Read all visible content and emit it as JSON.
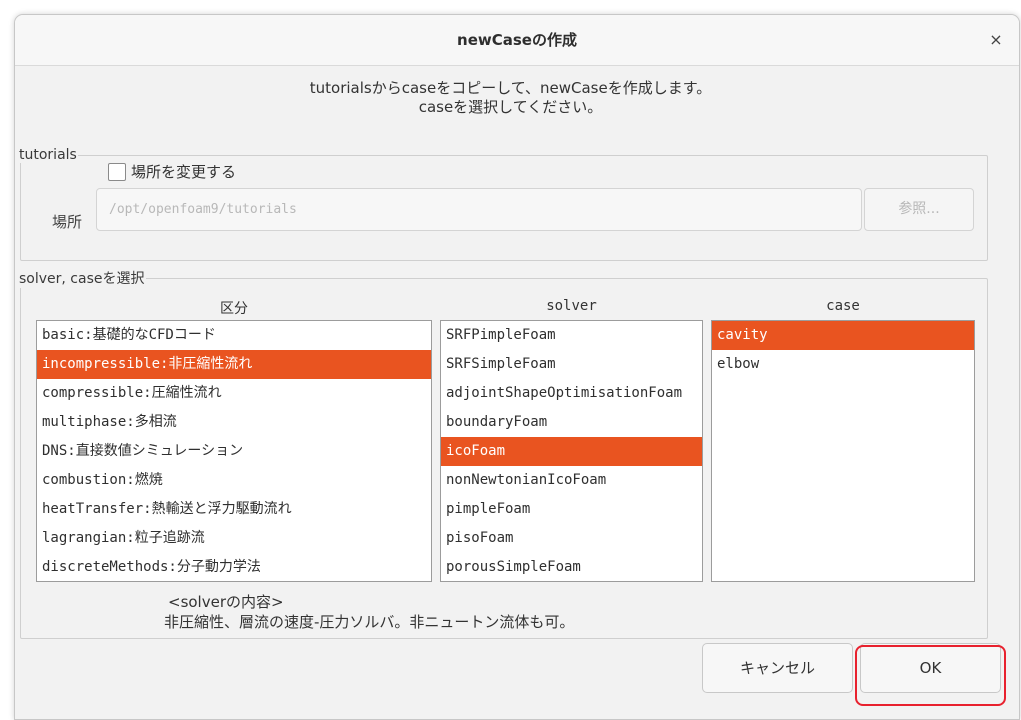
{
  "dialog": {
    "title": "newCaseの作成",
    "close_symbol": "×",
    "intro_line1": "tutorialsからcaseをコピーして、newCaseを作成します。",
    "intro_line2": "caseを選択してください。"
  },
  "tutorials": {
    "legend": "tutorials",
    "change_location_label": "場所を変更する",
    "change_location_checked": false,
    "location_label": "場所",
    "location_value": "/opt/openfoam9/tutorials",
    "browse_label": "参照..."
  },
  "selection": {
    "legend": "solver, caseを選択",
    "category_header": "区分",
    "solver_header": "solver",
    "case_header": "case",
    "categories": [
      {
        "label": "basic:基礎的なCFDコード",
        "selected": false
      },
      {
        "label": "incompressible:非圧縮性流れ",
        "selected": true
      },
      {
        "label": "compressible:圧縮性流れ",
        "selected": false
      },
      {
        "label": "multiphase:多相流",
        "selected": false
      },
      {
        "label": "DNS:直接数値シミュレーション",
        "selected": false
      },
      {
        "label": "combustion:燃焼",
        "selected": false
      },
      {
        "label": "heatTransfer:熱輸送と浮力駆動流れ",
        "selected": false
      },
      {
        "label": "lagrangian:粒子追跡流",
        "selected": false
      },
      {
        "label": "discreteMethods:分子動力学法",
        "selected": false
      }
    ],
    "solvers": [
      {
        "label": "SRFPimpleFoam",
        "selected": false
      },
      {
        "label": "SRFSimpleFoam",
        "selected": false
      },
      {
        "label": "adjointShapeOptimisationFoam",
        "selected": false
      },
      {
        "label": "boundaryFoam",
        "selected": false
      },
      {
        "label": "icoFoam",
        "selected": true
      },
      {
        "label": "nonNewtonianIcoFoam",
        "selected": false
      },
      {
        "label": "pimpleFoam",
        "selected": false
      },
      {
        "label": "pisoFoam",
        "selected": false
      },
      {
        "label": "porousSimpleFoam",
        "selected": false
      }
    ],
    "cases": [
      {
        "label": "cavity",
        "selected": true
      },
      {
        "label": "elbow",
        "selected": false
      }
    ],
    "solver_info_title": "<solverの内容>",
    "solver_info_text": "非圧縮性、層流の速度-圧力ソルバ。非ニュートン流体も可。"
  },
  "buttons": {
    "cancel_label": "キャンセル",
    "ok_label": "OK"
  },
  "colors": {
    "selection": "#e95420",
    "highlight_box": "#e8212e"
  }
}
